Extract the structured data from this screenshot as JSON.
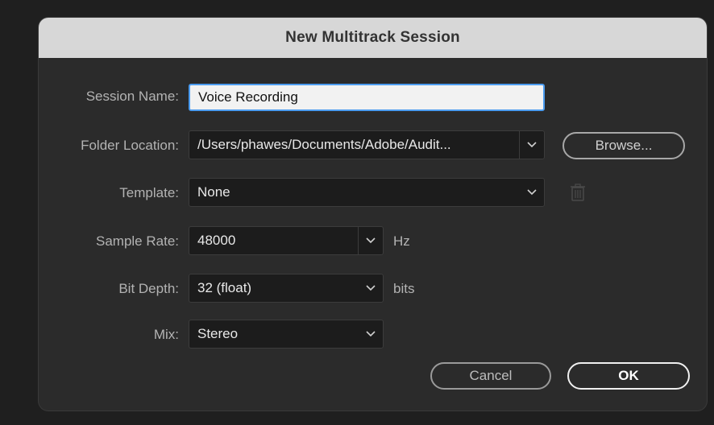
{
  "dialog": {
    "title": "New Multitrack Session"
  },
  "fields": {
    "session_name": {
      "label": "Session Name:",
      "value": "Voice Recording"
    },
    "folder_location": {
      "label": "Folder Location:",
      "value": "/Users/phawes/Documents/Adobe/Audit..."
    },
    "template": {
      "label": "Template:",
      "value": "None"
    },
    "sample_rate": {
      "label": "Sample Rate:",
      "value": "48000",
      "unit": "Hz"
    },
    "bit_depth": {
      "label": "Bit Depth:",
      "value": "32 (float)",
      "unit": "bits"
    },
    "mix": {
      "label": "Mix:",
      "value": "Stereo"
    }
  },
  "buttons": {
    "browse": "Browse...",
    "cancel": "Cancel",
    "ok": "OK"
  },
  "icons": {
    "dropdown": "chevron-down-icon",
    "delete_template": "trash-icon"
  },
  "colors": {
    "focus_border": "#4b9cf0",
    "title_bar": "#d7d7d7",
    "dialog_bg": "#2b2b2b"
  }
}
